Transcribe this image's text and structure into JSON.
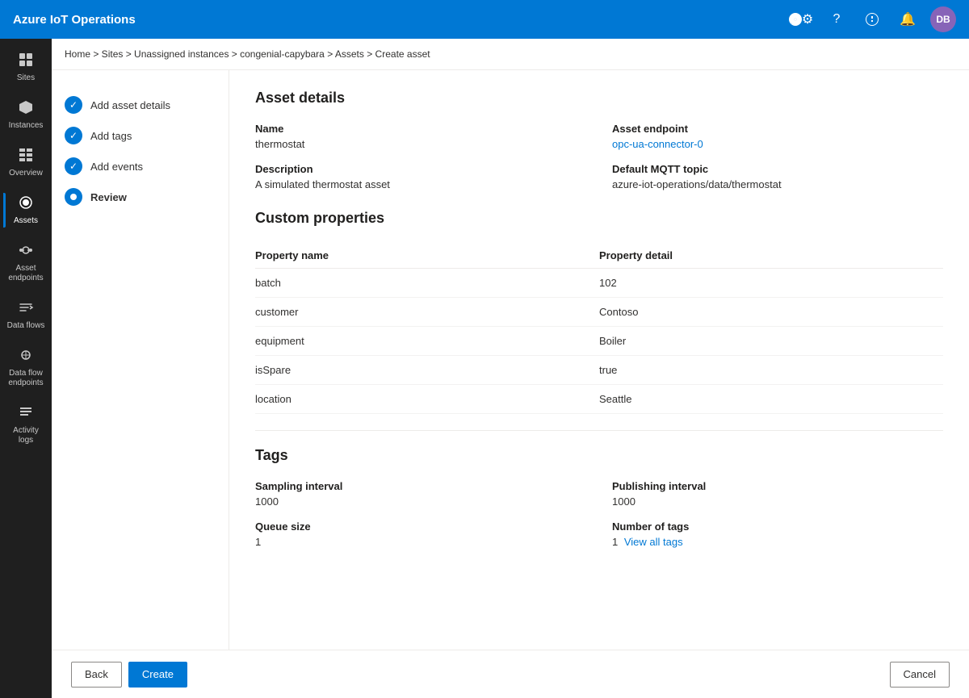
{
  "app": {
    "title": "Azure IoT Operations"
  },
  "topnav": {
    "settings_icon": "⚙",
    "help_icon": "?",
    "feedback_icon": "🔔",
    "notification_icon": "🔔",
    "avatar_initials": "DB"
  },
  "breadcrumb": {
    "text": "Home > Sites > Unassigned instances > congenial-capybara > Assets > Create asset"
  },
  "sidebar": {
    "items": [
      {
        "id": "sites",
        "label": "Sites",
        "icon": "⊞"
      },
      {
        "id": "instances",
        "label": "Instances",
        "icon": "⬡"
      },
      {
        "id": "overview",
        "label": "Overview",
        "icon": "▦"
      },
      {
        "id": "assets",
        "label": "Assets",
        "icon": "◈",
        "active": true
      },
      {
        "id": "asset-endpoints",
        "label": "Asset endpoints",
        "icon": "⊛"
      },
      {
        "id": "data-flows",
        "label": "Data flows",
        "icon": "⇄"
      },
      {
        "id": "data-flow-endpoints",
        "label": "Data flow endpoints",
        "icon": "⊕"
      },
      {
        "id": "activity-logs",
        "label": "Activity logs",
        "icon": "≡"
      }
    ]
  },
  "steps": [
    {
      "id": "add-asset-details",
      "label": "Add asset details",
      "state": "completed"
    },
    {
      "id": "add-tags",
      "label": "Add tags",
      "state": "completed"
    },
    {
      "id": "add-events",
      "label": "Add events",
      "state": "completed"
    },
    {
      "id": "review",
      "label": "Review",
      "state": "active"
    }
  ],
  "asset_details": {
    "section_title": "Asset details",
    "name_label": "Name",
    "name_value": "thermostat",
    "endpoint_label": "Asset endpoint",
    "endpoint_value": "opc-ua-connector-0",
    "description_label": "Description",
    "description_value": "A simulated thermostat asset",
    "mqtt_label": "Default MQTT topic",
    "mqtt_value": "azure-iot-operations/data/thermostat"
  },
  "custom_properties": {
    "section_title": "Custom properties",
    "col_name": "Property name",
    "col_detail": "Property detail",
    "rows": [
      {
        "name": "batch",
        "detail": "102"
      },
      {
        "name": "customer",
        "detail": "Contoso"
      },
      {
        "name": "equipment",
        "detail": "Boiler"
      },
      {
        "name": "isSpare",
        "detail": "true"
      },
      {
        "name": "location",
        "detail": "Seattle"
      }
    ]
  },
  "tags": {
    "section_title": "Tags",
    "sampling_interval_label": "Sampling interval",
    "sampling_interval_value": "1000",
    "publishing_interval_label": "Publishing interval",
    "publishing_interval_value": "1000",
    "queue_size_label": "Queue size",
    "queue_size_value": "1",
    "number_of_tags_label": "Number of tags",
    "number_of_tags_value": "1",
    "view_all_tags_label": "View all tags"
  },
  "footer": {
    "back_label": "Back",
    "create_label": "Create",
    "cancel_label": "Cancel"
  }
}
